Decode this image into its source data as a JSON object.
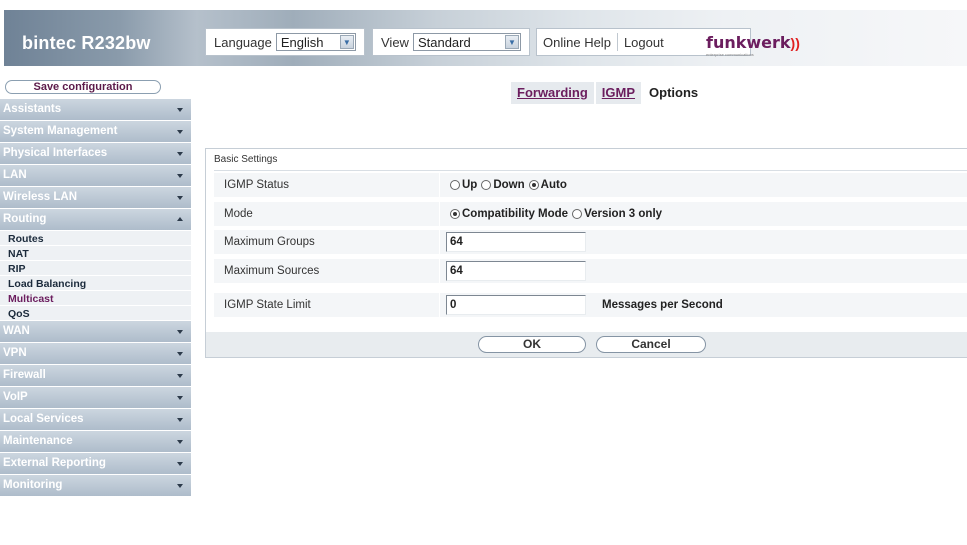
{
  "header": {
    "product": "bintec R232bw",
    "language_label": "Language",
    "language_value": "English",
    "view_label": "View",
    "view_value": "Standard",
    "online_help": "Online Help",
    "logout": "Logout",
    "logo_text": "funkwerk",
    "logo_waves": "))",
    "logo_tagline": "enterprise communications"
  },
  "sidebar": {
    "save_configuration": "Save configuration",
    "menu": [
      {
        "label": "Assistants"
      },
      {
        "label": "System Management"
      },
      {
        "label": "Physical Interfaces"
      },
      {
        "label": "LAN"
      },
      {
        "label": "Wireless LAN"
      },
      {
        "label": "Routing",
        "expanded": true,
        "sub": [
          "Routes",
          "NAT",
          "RIP",
          "Load Balancing",
          "Multicast",
          "QoS"
        ],
        "active_sub": "Multicast"
      },
      {
        "label": "WAN"
      },
      {
        "label": "VPN"
      },
      {
        "label": "Firewall"
      },
      {
        "label": "VoIP"
      },
      {
        "label": "Local Services"
      },
      {
        "label": "Maintenance"
      },
      {
        "label": "External Reporting"
      },
      {
        "label": "Monitoring"
      }
    ]
  },
  "tabs": [
    {
      "label": "Forwarding"
    },
    {
      "label": "IGMP"
    },
    {
      "label": "Options",
      "active": true
    }
  ],
  "form": {
    "section_title": "Basic Settings",
    "igmp_status": {
      "label": "IGMP Status",
      "options": [
        "Up",
        "Down",
        "Auto"
      ],
      "selected": "Auto"
    },
    "mode": {
      "label": "Mode",
      "options": [
        "Compatibility Mode",
        "Version 3 only"
      ],
      "selected": "Compatibility Mode"
    },
    "max_groups": {
      "label": "Maximum Groups",
      "value": "64"
    },
    "max_sources": {
      "label": "Maximum Sources",
      "value": "64"
    },
    "state_limit": {
      "label": "IGMP State Limit",
      "value": "0",
      "unit": "Messages per Second"
    }
  },
  "buttons": {
    "ok": "OK",
    "cancel": "Cancel"
  },
  "colors": {
    "accent": "#6b1d5e",
    "menu_bg": "#b4c2d0",
    "logo_red": "#e02020"
  }
}
